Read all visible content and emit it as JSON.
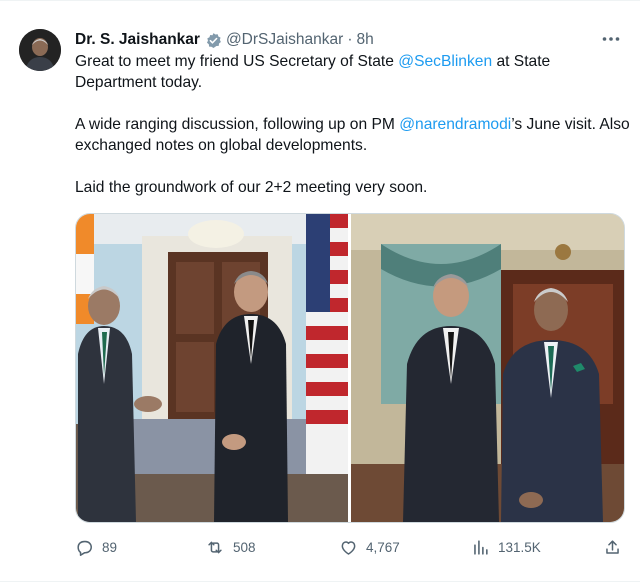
{
  "author": {
    "name": "Dr. S. Jaishankar",
    "handle": "@DrSJaishankar",
    "separator": "·",
    "time": "8h"
  },
  "tweet": {
    "p1_a": "Great to meet my friend US Secretary of State ",
    "p1_mention": "@SecBlinken",
    "p1_b": " at State Department today.",
    "p2_a": "A wide ranging discussion, following up on PM ",
    "p2_mention": "@narendramodi",
    "p2_b": "’s June visit. Also exchanged notes on global developments.",
    "p3": "Laid the groundwork of our 2+2 meeting very soon."
  },
  "metrics": {
    "replies": "89",
    "reposts": "508",
    "likes": "4,767",
    "views": "131.5K"
  },
  "icons": {
    "verified": "verified-badge-icon",
    "more": "more-dots-icon",
    "reply": "reply-icon",
    "repost": "repost-icon",
    "like": "like-icon",
    "views": "views-icon",
    "share": "share-icon"
  },
  "colors": {
    "accent": "#1d9bf0",
    "text": "#0f1419",
    "secondary": "#536471",
    "border": "#cfd9de"
  }
}
